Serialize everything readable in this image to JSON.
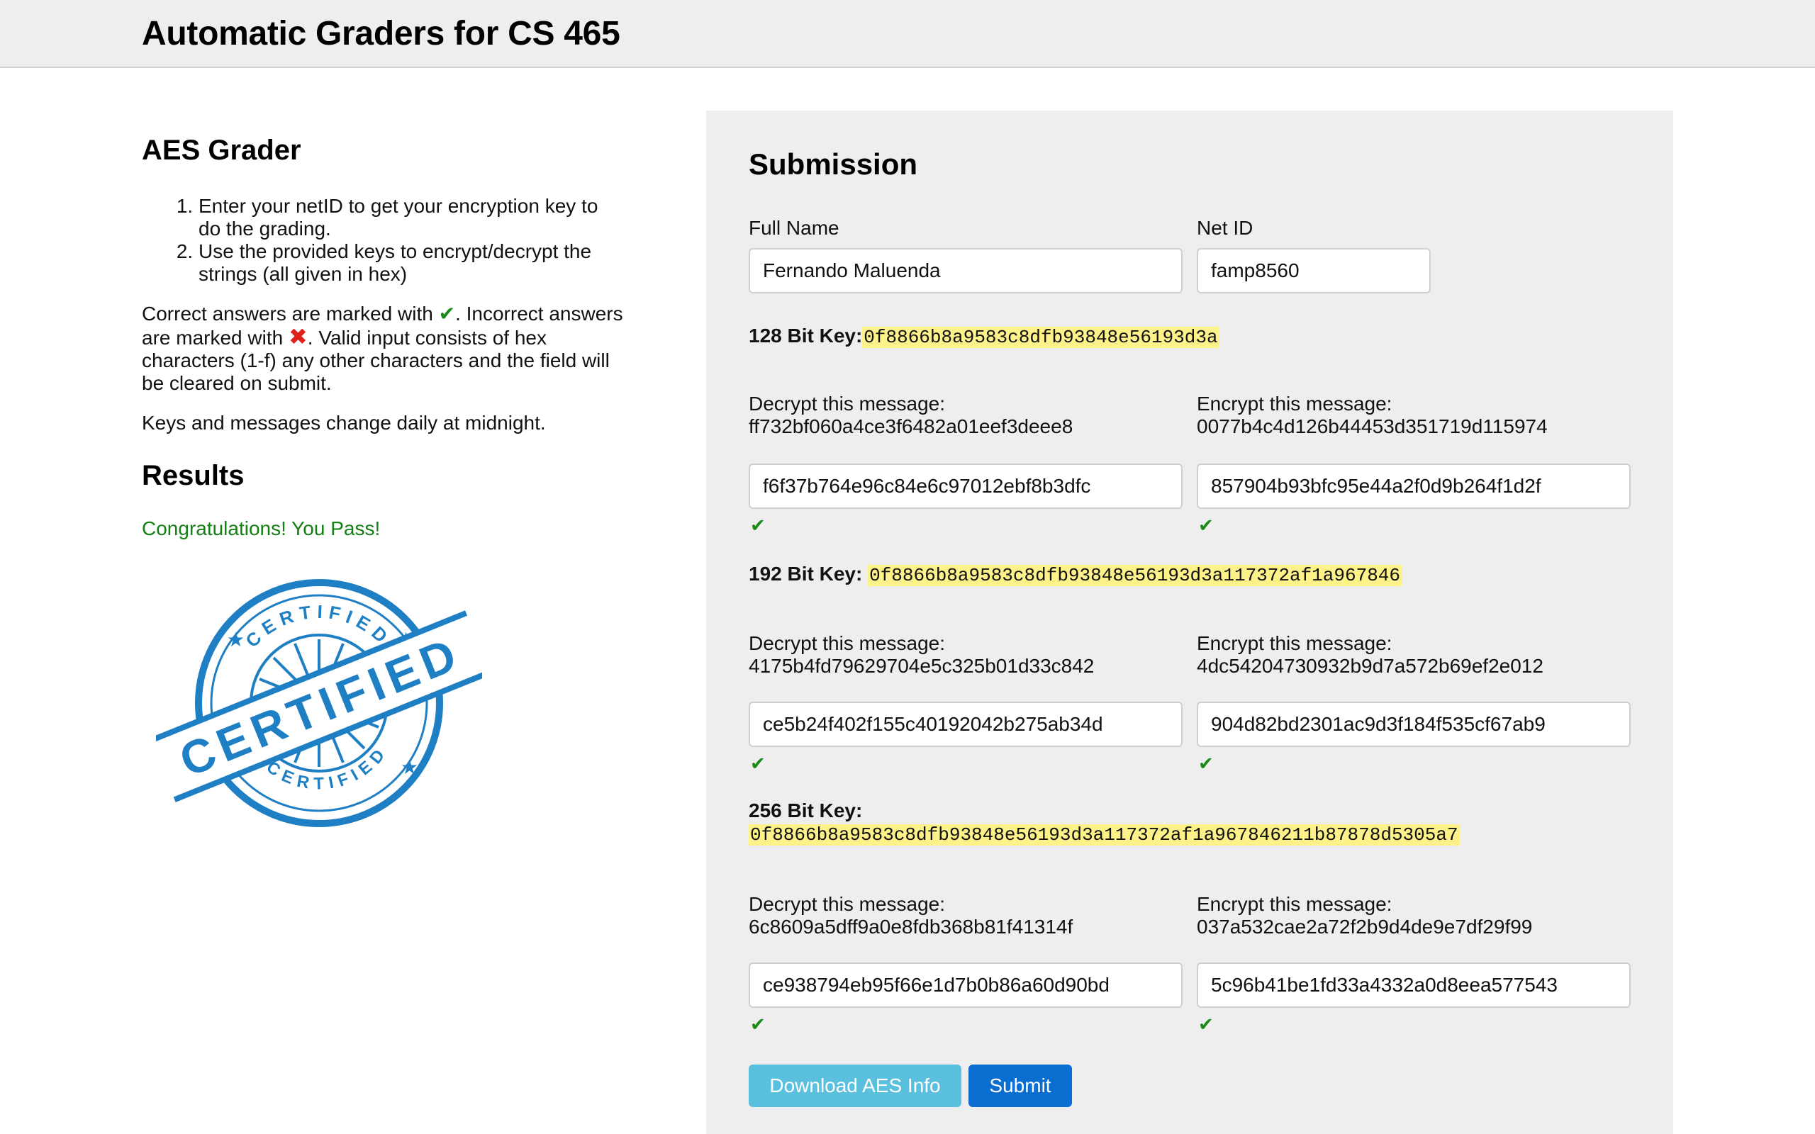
{
  "header": {
    "title": "Automatic Graders for CS 465"
  },
  "left": {
    "heading": "AES Grader",
    "instructions": [
      "Enter your netID to get your encryption key to do the grading.",
      "Use the provided keys to encrypt/decrypt the strings (all given in hex)"
    ],
    "correct_prefix": "Correct answers are marked with",
    "correct_mark": "✔",
    "incorrect_prefix": ". Incorrect answers are marked with",
    "incorrect_mark": "✖",
    "incorrect_suffix": ". Valid input consists of hex characters (1-f) any other characters and the field will be cleared on submit.",
    "keys_note": "Keys and messages change daily at midnight.",
    "results_heading": "Results",
    "result_message": "Congratulations! You Pass!",
    "stamp": {
      "top_text": "CERTIFIED",
      "bottom_text": "CERTIFIED",
      "banner_text": "CERTIFIED",
      "color": "#1f7fc4"
    }
  },
  "submission": {
    "heading": "Submission",
    "full_name_label": "Full Name",
    "full_name_value": "Fernando Maluenda",
    "net_id_label": "Net ID",
    "net_id_value": "famp8560",
    "key128_label": "128 Bit Key:",
    "key128_value": "0f8866b8a9583c8dfb93848e56193d3a",
    "key192_label": "192 Bit Key:",
    "key192_value": "0f8866b8a9583c8dfb93848e56193d3a117372af1a967846",
    "key256_label": "256 Bit Key:",
    "key256_value": "0f8866b8a9583c8dfb93848e56193d3a117372af1a967846211b87878d5305a7",
    "decrypt_label": "Decrypt this message:",
    "encrypt_label": "Encrypt this message:",
    "check_mark": "✔",
    "groups": [
      {
        "decrypt_msg": "ff732bf060a4ce3f6482a01eef3deee8",
        "encrypt_msg": "0077b4c4d126b44453d351719d115974",
        "decrypt_answer": "f6f37b764e96c84e6c97012ebf8b3dfc",
        "encrypt_answer": "857904b93bfc95e44a2f0d9b264f1d2f"
      },
      {
        "decrypt_msg": "4175b4fd79629704e5c325b01d33c842",
        "encrypt_msg": "4dc54204730932b9d7a572b69ef2e012",
        "decrypt_answer": "ce5b24f402f155c40192042b275ab34d",
        "encrypt_answer": "904d82bd2301ac9d3f184f535cf67ab9"
      },
      {
        "decrypt_msg": "6c8609a5dff9a0e8fdb368b81f41314f",
        "encrypt_msg": "037a532cae2a72f2b9d4de9e7df29f99",
        "decrypt_answer": "ce938794eb95f66e1d7b0b86a60d90bd",
        "encrypt_answer": "5c96b41be1fd33a4332a0d8eea577543"
      }
    ],
    "download_button": "Download AES Info",
    "submit_button": "Submit"
  },
  "colors": {
    "header_bg": "#eeeeee",
    "panel_bg": "#eeeeee",
    "key_highlight": "#fdf28a",
    "success": "#138013",
    "error": "#e0201a",
    "info_button": "#5bc0de",
    "primary_button": "#0a6ed1"
  }
}
